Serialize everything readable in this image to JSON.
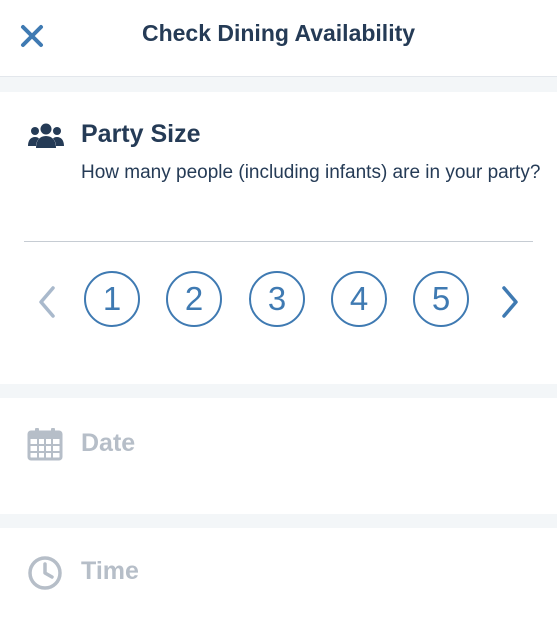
{
  "header": {
    "title": "Check Dining Availability"
  },
  "party": {
    "title": "Party Size",
    "description": "How many people (including infants) are in your party?",
    "options": [
      "1",
      "2",
      "3",
      "4",
      "5"
    ]
  },
  "date_section": {
    "label": "Date"
  },
  "time_section": {
    "label": "Time"
  },
  "icons": {
    "close": "close-icon",
    "party": "people-group-icon",
    "prev": "chevron-left-icon",
    "next": "chevron-right-icon",
    "date": "calendar-icon",
    "time": "clock-icon"
  },
  "colors": {
    "primary_blue": "#3f7ab2",
    "title_navy": "#253b56",
    "disabled_gray": "#b6bec8",
    "section_gap": "#f3f6f8"
  }
}
